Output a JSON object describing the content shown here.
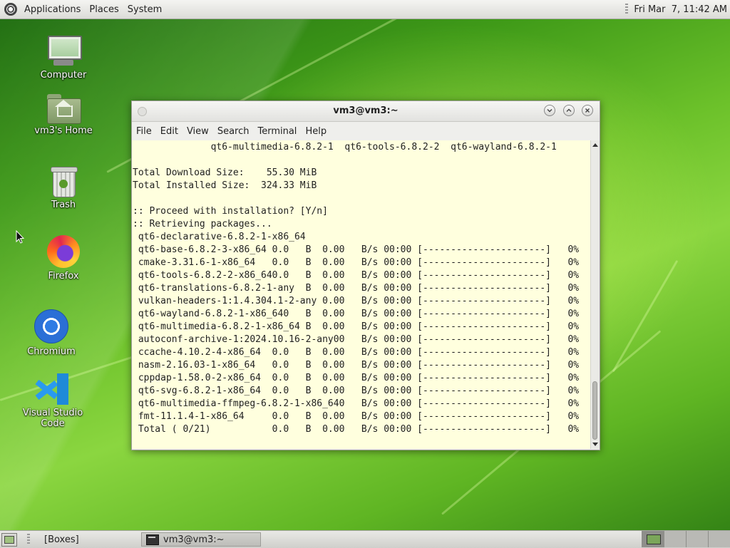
{
  "top_panel": {
    "menus": [
      "Applications",
      "Places",
      "System"
    ],
    "clock": "Fri Mar  7, 11:42 AM"
  },
  "desktop_icons": [
    {
      "label": "Computer",
      "icon": "computer-icon"
    },
    {
      "label": "vm3's Home",
      "icon": "home-folder-icon"
    },
    {
      "label": "Trash",
      "icon": "trash-icon"
    },
    {
      "label": "Firefox",
      "icon": "firefox-icon"
    },
    {
      "label": "Chromium",
      "icon": "chromium-icon"
    },
    {
      "label": "Visual Studio Code",
      "icon": "vscode-icon"
    }
  ],
  "terminal": {
    "title": "vm3@vm3:~",
    "menus": [
      "File",
      "Edit",
      "View",
      "Search",
      "Terminal",
      "Help"
    ],
    "lines": [
      "              qt6-multimedia-6.8.2-1  qt6-tools-6.8.2-2  qt6-wayland-6.8.2-1",
      "",
      "Total Download Size:    55.30 MiB",
      "Total Installed Size:  324.33 MiB",
      "",
      ":: Proceed with installation? [Y/n]",
      ":: Retrieving packages...",
      " qt6-declarative-6.8.2-1-x86_64",
      " qt6-base-6.8.2-3-x86_64 0.0   B  0.00   B/s 00:00 [----------------------]   0%",
      " cmake-3.31.6-1-x86_64   0.0   B  0.00   B/s 00:00 [----------------------]   0%",
      " qt6-tools-6.8.2-2-x86_640.0   B  0.00   B/s 00:00 [----------------------]   0%",
      " qt6-translations-6.8.2-1-any  B  0.00   B/s 00:00 [----------------------]   0%",
      " vulkan-headers-1:1.4.304.1-2-any 0.00   B/s 00:00 [----------------------]   0%",
      " qt6-wayland-6.8.2-1-x86_640   B  0.00   B/s 00:00 [----------------------]   0%",
      " qt6-multimedia-6.8.2-1-x86_64 B  0.00   B/s 00:00 [----------------------]   0%",
      " autoconf-archive-1:2024.10.16-2-any00   B/s 00:00 [----------------------]   0%",
      " ccache-4.10.2-4-x86_64  0.0   B  0.00   B/s 00:00 [----------------------]   0%",
      " nasm-2.16.03-1-x86_64   0.0   B  0.00   B/s 00:00 [----------------------]   0%",
      " cppdap-1.58.0-2-x86_64  0.0   B  0.00   B/s 00:00 [----------------------]   0%",
      " qt6-svg-6.8.2-1-x86_64  0.0   B  0.00   B/s 00:00 [----------------------]   0%",
      " qt6-multimedia-ffmpeg-6.8.2-1-x86_640   B/s 00:00 [----------------------]   0%",
      " fmt-11.1.4-1-x86_64     0.0   B  0.00   B/s 00:00 [----------------------]   0%",
      " Total ( 0/21)           0.0   B  0.00   B/s 00:00 [----------------------]   0%"
    ]
  },
  "bottom_panel": {
    "tasks": [
      "[Boxes]",
      "vm3@vm3:~"
    ]
  },
  "colors": {
    "terminal_bg": "#ffffde",
    "terminal_fg": "#222222"
  }
}
